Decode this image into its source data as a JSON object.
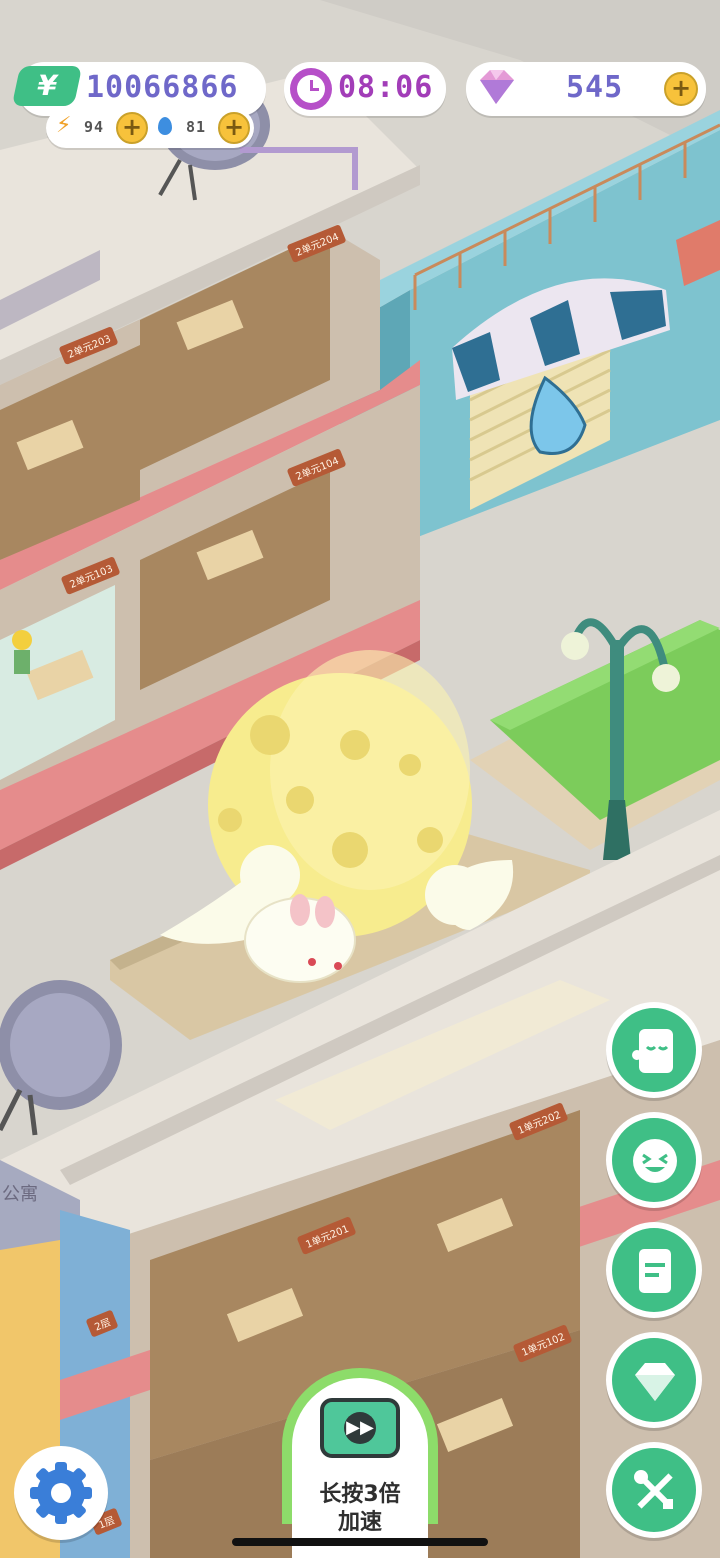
{
  "hud": {
    "money": {
      "icon": "yen-banknote-icon",
      "value": "10066866"
    },
    "energy": {
      "icon": "lightning-icon",
      "value": "94"
    },
    "water": {
      "icon": "water-drop-icon",
      "value": "81"
    },
    "timer": {
      "icon": "clock-icon",
      "value": "08:06"
    },
    "gems": {
      "icon": "gem-icon",
      "value": "545"
    },
    "plus_label": "+"
  },
  "rooms": {
    "r204": "2单元204",
    "r203": "2单元203",
    "r104": "2单元104",
    "r103": "2单元103",
    "r202": "1单元202",
    "r201": "1单元201",
    "r102": "1单元102",
    "f2": "2层",
    "f1": "1层",
    "building_sign": "公寓"
  },
  "side_buttons": [
    {
      "icon": "ghost-card-icon"
    },
    {
      "icon": "laughing-face-icon"
    },
    {
      "icon": "notepad-icon"
    },
    {
      "icon": "diamond-icon"
    },
    {
      "icon": "tools-icon"
    }
  ],
  "speed_button": {
    "icon": "tv-fast-forward-icon",
    "line1": "长按3倍",
    "line2": "加速"
  },
  "settings": {
    "icon": "gear-icon"
  },
  "colors": {
    "accent_green": "#3fbf86",
    "hud_text": "#6f68c9",
    "plus_gold": "#f7c23b",
    "moon_yellow": "#f7ec8e",
    "floor_pink": "#e07b7b"
  }
}
